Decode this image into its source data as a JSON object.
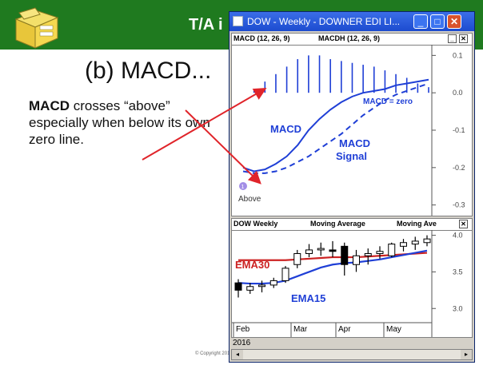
{
  "slide": {
    "header_title": "T/A i",
    "heading": "(b) MACD...",
    "body_bold": "MACD",
    "body_rest": " crosses “above” especially when below its own zero line.",
    "copyright": "© Copyright 201"
  },
  "window": {
    "title": "DOW - Weekly - DOWNER EDI LI...",
    "min_glyph": "_",
    "max_glyph": "□",
    "close_glyph": "✕"
  },
  "macd_pane": {
    "header_left": "MACD (12, 26, 9)",
    "header_right": "MACDH (12, 26, 9)",
    "ctrl_min": "_",
    "ctrl_close": "✕",
    "annot_macd": "MACD",
    "annot_signal_1": "MACD",
    "annot_signal_2": "Signal",
    "annot_zero": "MACD = zero",
    "annot_above": "Above",
    "marker": "1",
    "yticks": [
      "0.1",
      "0.0",
      "-0.1",
      "-0.2",
      "-0.3"
    ],
    "yvalues": [
      0.1,
      0.0,
      -0.1,
      -0.2,
      -0.3
    ],
    "ylim": [
      -0.32,
      0.12
    ],
    "histogram": [
      0.0,
      0.01,
      0.03,
      0.05,
      0.07,
      0.09,
      0.1,
      0.1,
      0.09,
      0.085,
      0.08,
      0.075,
      0.07,
      0.06,
      0.05,
      0.04,
      0.025,
      0.015
    ],
    "macd_line": [
      -0.2,
      -0.21,
      -0.205,
      -0.19,
      -0.17,
      -0.14,
      -0.1,
      -0.07,
      -0.045,
      -0.025,
      -0.01,
      0.0,
      0.005,
      0.01,
      0.02,
      0.025,
      0.03,
      0.035
    ],
    "signal_line": [
      -0.21,
      -0.215,
      -0.215,
      -0.21,
      -0.2,
      -0.185,
      -0.17,
      -0.15,
      -0.13,
      -0.11,
      -0.085,
      -0.06,
      -0.04,
      -0.02,
      -0.005,
      0.005,
      0.015,
      0.025
    ],
    "colors": {
      "line": "#1f3fd6",
      "hist": "#1f3fd6",
      "arrow": "#e0242a",
      "marker": "#a38ee6"
    }
  },
  "price_pane": {
    "header_left": "DOW Weekly",
    "header_mid": "Moving Average",
    "header_right": "Moving Ave",
    "ctrl_close": "✕",
    "label_ema30": "EMA30",
    "label_ema15": "EMA15",
    "yticks": [
      "4.0",
      "3.5",
      "3.0"
    ],
    "yvalues": [
      4.0,
      3.5,
      3.0
    ],
    "ylim": [
      2.85,
      4.05
    ],
    "x_months": [
      "Feb",
      "Mar",
      "Apr",
      "May"
    ],
    "year": "2016",
    "candles": [
      {
        "o": 3.35,
        "c": 3.25,
        "h": 3.4,
        "l": 3.15
      },
      {
        "o": 3.25,
        "c": 3.3,
        "h": 3.35,
        "l": 3.2
      },
      {
        "o": 3.3,
        "c": 3.32,
        "h": 3.38,
        "l": 3.22
      },
      {
        "o": 3.32,
        "c": 3.38,
        "h": 3.42,
        "l": 3.28
      },
      {
        "o": 3.38,
        "c": 3.55,
        "h": 3.58,
        "l": 3.35
      },
      {
        "o": 3.6,
        "c": 3.75,
        "h": 3.8,
        "l": 3.55
      },
      {
        "o": 3.75,
        "c": 3.8,
        "h": 3.88,
        "l": 3.7
      },
      {
        "o": 3.8,
        "c": 3.82,
        "h": 3.9,
        "l": 3.72
      },
      {
        "o": 3.8,
        "c": 3.78,
        "h": 3.92,
        "l": 3.7
      },
      {
        "o": 3.85,
        "c": 3.6,
        "h": 3.9,
        "l": 3.45
      },
      {
        "o": 3.6,
        "c": 3.72,
        "h": 3.8,
        "l": 3.5
      },
      {
        "o": 3.72,
        "c": 3.75,
        "h": 3.82,
        "l": 3.6
      },
      {
        "o": 3.75,
        "c": 3.78,
        "h": 3.85,
        "l": 3.68
      },
      {
        "o": 3.72,
        "c": 3.88,
        "h": 3.9,
        "l": 3.7
      },
      {
        "o": 3.85,
        "c": 3.9,
        "h": 3.95,
        "l": 3.78
      },
      {
        "o": 3.88,
        "c": 3.92,
        "h": 3.98,
        "l": 3.8
      },
      {
        "o": 3.9,
        "c": 3.95,
        "h": 4.0,
        "l": 3.85
      }
    ],
    "ema30": [
      3.66,
      3.66,
      3.66,
      3.66,
      3.66,
      3.67,
      3.68,
      3.69,
      3.7,
      3.7,
      3.7,
      3.71,
      3.72,
      3.73,
      3.74,
      3.75,
      3.76
    ],
    "ema15": [
      3.35,
      3.34,
      3.34,
      3.35,
      3.38,
      3.44,
      3.5,
      3.56,
      3.6,
      3.62,
      3.63,
      3.65,
      3.67,
      3.7,
      3.73,
      3.76,
      3.79
    ],
    "colors": {
      "ema30": "#cc2222",
      "ema15": "#1f3fd6",
      "candle": "#000000"
    }
  }
}
